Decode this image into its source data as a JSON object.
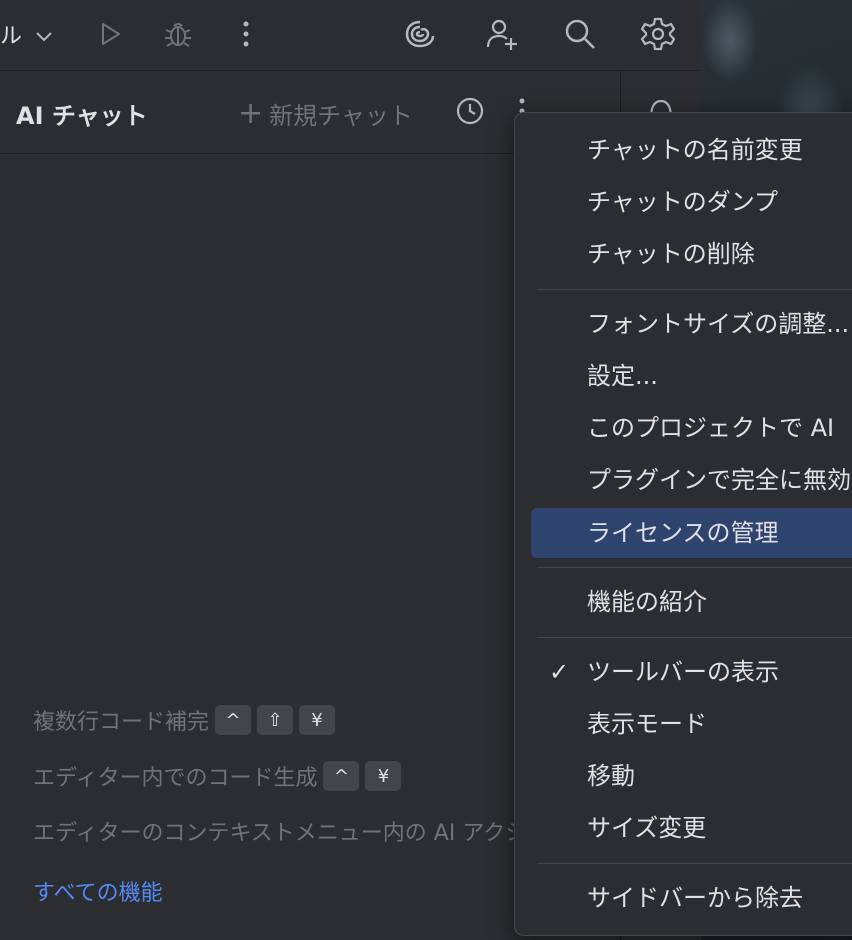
{
  "toolbar": {
    "partial_label": "ル",
    "icons": [
      "chevron-down-icon",
      "run-icon",
      "debug-icon",
      "more-vertical-icon",
      "ai-assistant-icon",
      "add-user-icon",
      "search-icon",
      "settings-icon"
    ]
  },
  "panel": {
    "title": "AI チャット",
    "new_chat": "新規チャット",
    "new_chat_plus": "+"
  },
  "hints": {
    "multiline": "複数行コード補完",
    "multiline_keys": [
      "^",
      "⇧",
      "¥"
    ],
    "in_editor": "エディター内でのコード生成",
    "in_editor_keys": [
      "^",
      "¥"
    ],
    "context_menu": "エディターのコンテキストメニュー内の AI アクション",
    "all_features": "すべての機能"
  },
  "menu": {
    "items": [
      "チャットの名前変更",
      "チャットのダンプ",
      "チャットの削除",
      "フォントサイズの調整...",
      "設定...",
      "このプロジェクトで AI",
      "プラグインで完全に無効",
      "ライセンスの管理",
      "機能の紹介",
      "ツールバーの表示",
      "表示モード",
      "移動",
      "サイズ変更",
      "サイドバーから除去"
    ],
    "check_mark": "✓",
    "selected_index": 7,
    "selected_color": "#2e436e"
  },
  "colors": {
    "background": "#2b2d30",
    "link": "#548af7",
    "muted_text": "#6f737a"
  }
}
